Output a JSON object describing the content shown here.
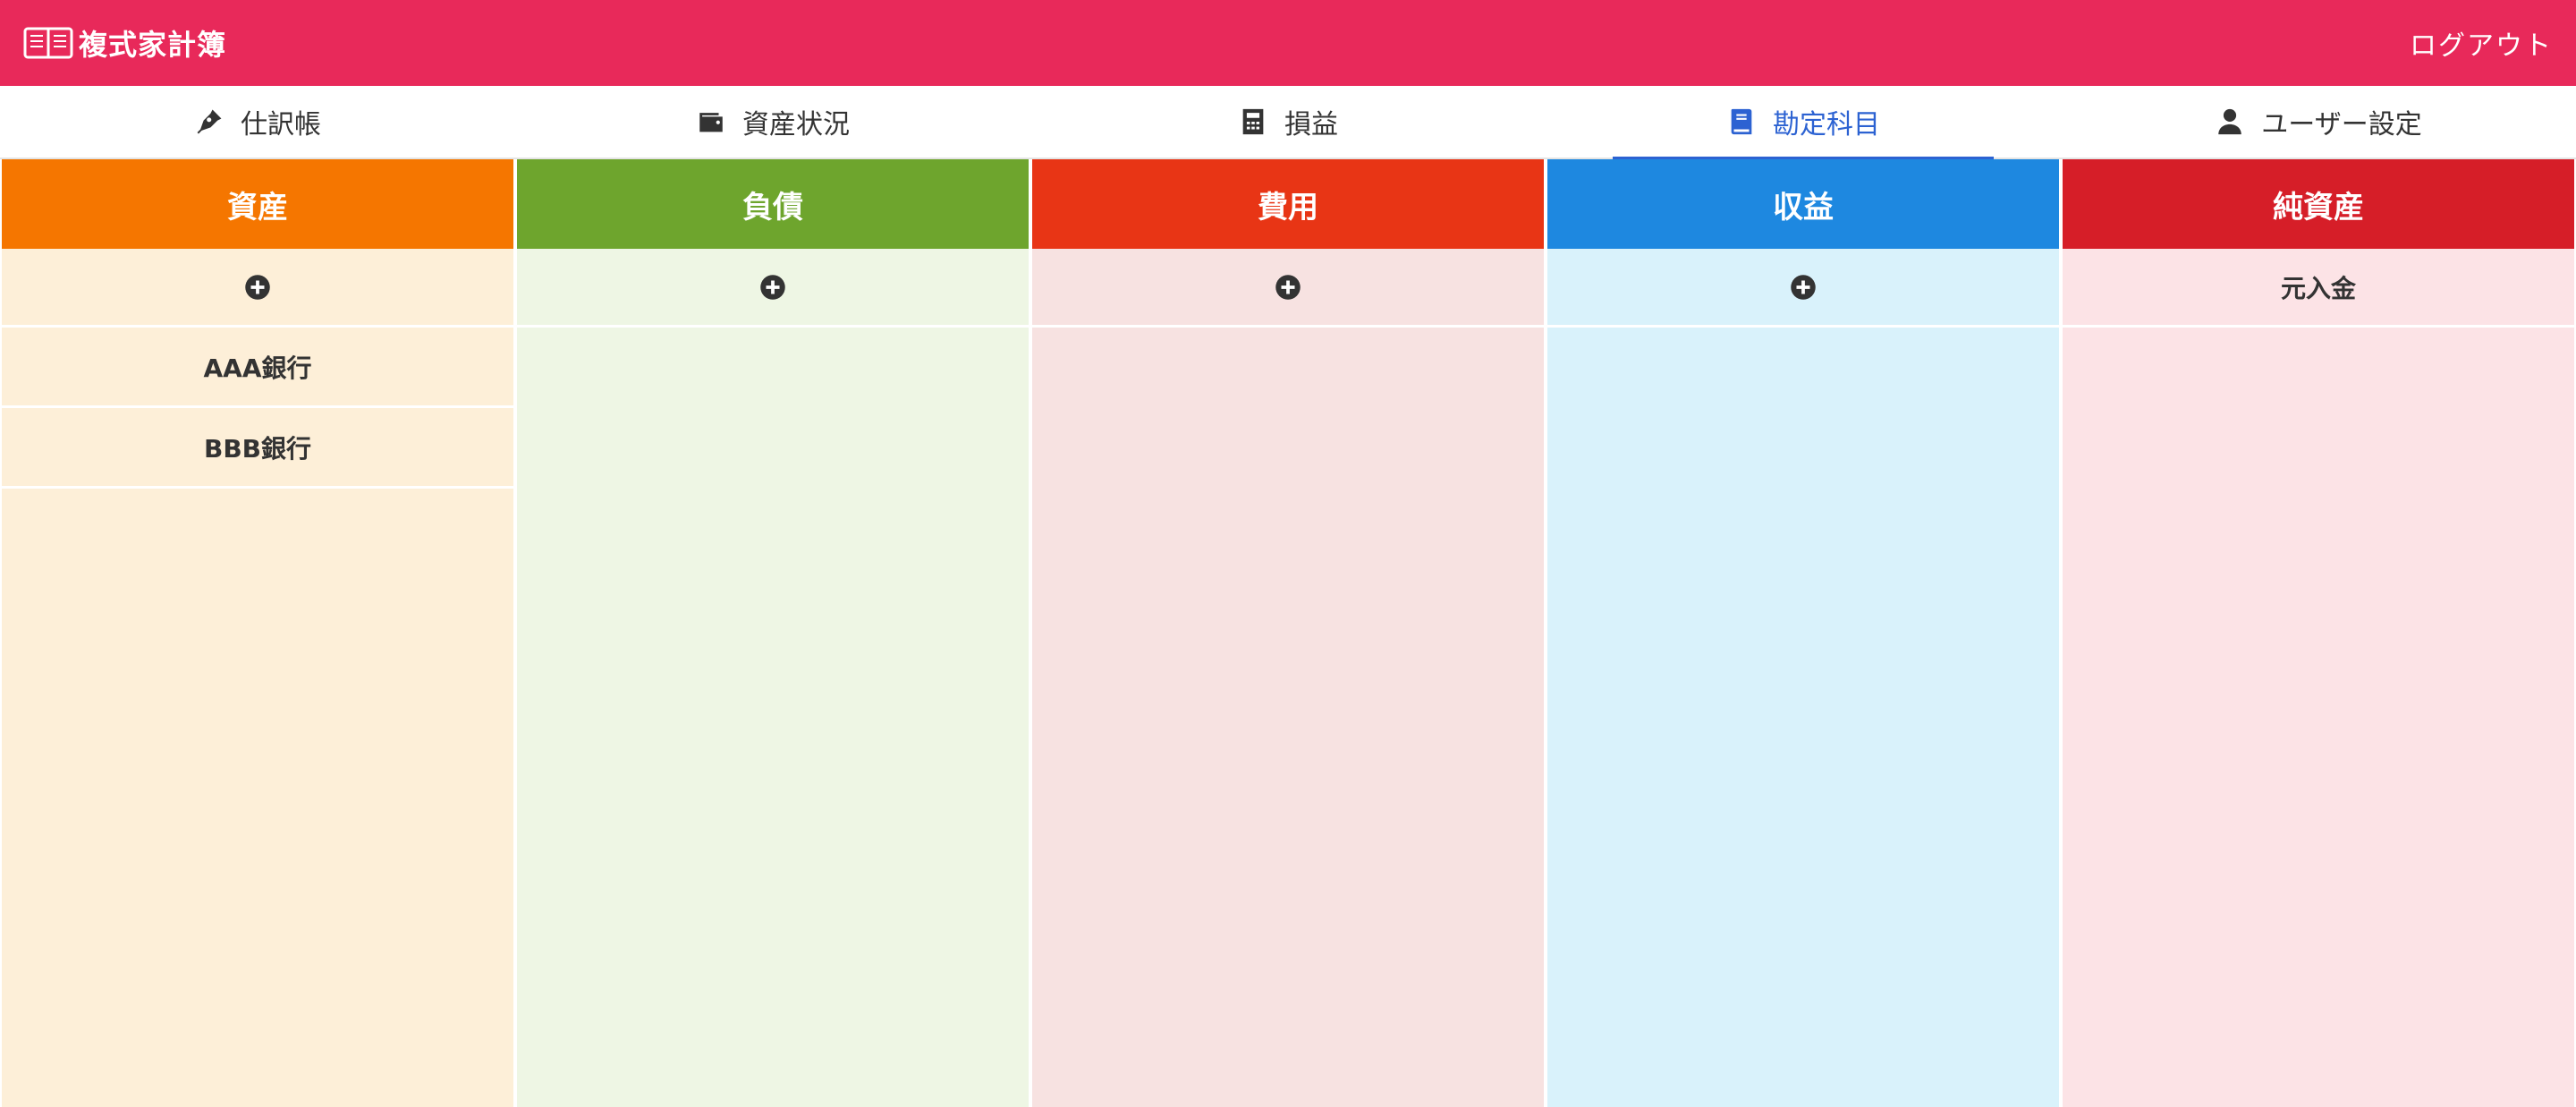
{
  "header": {
    "title": "複式家計簿",
    "logout_label": "ログアウト",
    "brand_icon": "open-book-icon",
    "color": "#e8295a"
  },
  "nav": {
    "items": [
      {
        "label": "仕訳帳",
        "icon": "pen-nib-icon",
        "active": false
      },
      {
        "label": "資産状況",
        "icon": "wallet-icon",
        "active": false
      },
      {
        "label": "損益",
        "icon": "calculator-icon",
        "active": false
      },
      {
        "label": "勘定科目",
        "icon": "book-icon",
        "active": true
      },
      {
        "label": "ユーザー設定",
        "icon": "user-icon",
        "active": false
      }
    ],
    "active_color": "#2c62d2"
  },
  "columns": [
    {
      "title": "資産",
      "head_color": "#f57600",
      "body_color": "#fdefd8",
      "add_icon": "plus-circle-icon",
      "items": [
        "AAA銀行",
        "BBB銀行"
      ]
    },
    {
      "title": "負債",
      "head_color": "#6ea52d",
      "body_color": "#eef6e4",
      "add_icon": "plus-circle-icon",
      "items": []
    },
    {
      "title": "費用",
      "head_color": "#e83515",
      "body_color": "#f7e2e1",
      "add_icon": "plus-circle-icon",
      "items": []
    },
    {
      "title": "収益",
      "head_color": "#1e88e0",
      "body_color": "#d9f2fb",
      "add_icon": "plus-circle-icon",
      "items": []
    },
    {
      "title": "純資産",
      "head_color": "#d61e28",
      "body_color": "#fce3e6",
      "fixed_label": "元入金",
      "items": []
    }
  ]
}
